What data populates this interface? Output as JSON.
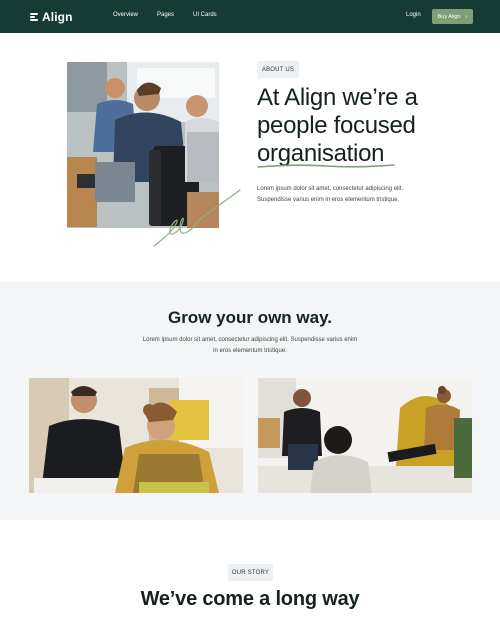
{
  "nav": {
    "brand": "Align",
    "links": [
      "Overview",
      "Pages",
      "UI Cards"
    ],
    "login": "Login",
    "cta": "Buy Align",
    "cta_arrow": "›"
  },
  "about": {
    "tag": "ABOUT US",
    "heading_lines": [
      "At Align we’re a",
      "people focused",
      "organisation"
    ],
    "body": "Lorem ipsum dolor sit amet, consectetur adipiscing elit. Suspendisse varius enim in eros elementum tristique."
  },
  "grow": {
    "heading": "Grow your own way.",
    "body": "Lorem ipsum dolor sit amet, consectetur adipiscing elit. Suspendisse varius enim in eros elementum tristique."
  },
  "story": {
    "tag": "OUR STORY",
    "heading": "We’ve come a long way"
  },
  "colors": {
    "nav_bg": "#163a34",
    "accent": "#7e9f78",
    "section_bg": "#f4f5f6"
  }
}
